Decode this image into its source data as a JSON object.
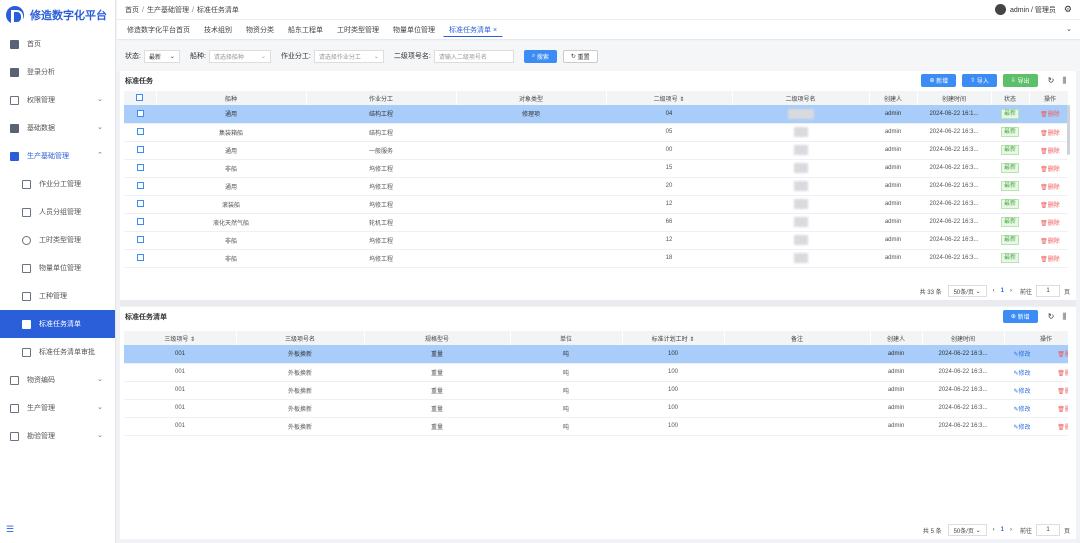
{
  "app": {
    "title": "修造数字化平台"
  },
  "sidebar": {
    "items": [
      {
        "label": "首页",
        "icon": "home-icon"
      },
      {
        "label": "登录分析",
        "icon": "monitor-icon"
      },
      {
        "label": "权限管理",
        "icon": "window-icon",
        "chevron": "chevron-down"
      },
      {
        "label": "基础数据",
        "icon": "database-icon",
        "chevron": "chevron-down"
      },
      {
        "label": "生产基础管理",
        "icon": "folder-icon",
        "chevron": "chevron-up"
      }
    ],
    "subitems": [
      {
        "label": "作业分工管理",
        "icon": "doc-icon"
      },
      {
        "label": "人员分组管理",
        "icon": "people-icon"
      },
      {
        "label": "工时类型管理",
        "icon": "search-icon"
      },
      {
        "label": "物量单位管理",
        "icon": "scale-icon"
      },
      {
        "label": "工种管理",
        "icon": "monitor-icon"
      },
      {
        "label": "标准任务清单",
        "icon": "task-icon",
        "active": true
      },
      {
        "label": "标准任务清单审批",
        "icon": "approve-icon"
      }
    ],
    "bottom_items": [
      {
        "label": "物资编码",
        "icon": "box-icon",
        "chevron": "chevron-down"
      },
      {
        "label": "生产管理",
        "icon": "doc-icon",
        "chevron": "chevron-down"
      },
      {
        "label": "勘验管理",
        "icon": "window-icon",
        "chevron": "chevron-down"
      }
    ],
    "collapse_icon": "indent-icon"
  },
  "breadcrumb": [
    "首页",
    "生产基础管理",
    "标准任务清单"
  ],
  "user": {
    "label": "admin / 管理员"
  },
  "tabs": [
    "修造数字化平台首页",
    "技术组别",
    "物资分类",
    "船东工程单",
    "工时类型管理",
    "物量单位管理",
    "标准任务清单 ×"
  ],
  "filters": {
    "status_label": "状态:",
    "status_value": "最新",
    "ship_label": "船种:",
    "ship_placeholder": "请选择船种",
    "work_label": "作业分工:",
    "work_placeholder": "请选择作业分工",
    "item2_label": "二级项号名:",
    "item2_placeholder": "请输入二级项号名",
    "search_btn": "搜索",
    "reset_btn": "重置"
  },
  "upper": {
    "title": "标准任务",
    "add_btn": "新增",
    "import_btn": "导入",
    "export_btn": "导出",
    "headers": [
      "船种",
      "作业分工",
      "对象类型",
      "二级项号",
      "二级项号名",
      "创建人",
      "创建时间",
      "状态",
      "操作"
    ],
    "rows": [
      [
        "通用",
        "结构工程",
        "修理项",
        "04",
        "admin",
        "2024-06-22 16:1...",
        "最新",
        "删除"
      ],
      [
        "集装箱船",
        "结构工程",
        "",
        "05",
        "admin",
        "2024-06-22 16:3...",
        "最新",
        "删除"
      ],
      [
        "通用",
        "一般服务",
        "",
        "00",
        "admin",
        "2024-06-22 16:3...",
        "最新",
        "删除"
      ],
      [
        "非船",
        "坞修工程",
        "",
        "15",
        "admin",
        "2024-06-22 16:3...",
        "最新",
        "删除"
      ],
      [
        "通用",
        "坞修工程",
        "",
        "20",
        "admin",
        "2024-06-22 16:3...",
        "最新",
        "删除"
      ],
      [
        "滚装船",
        "坞修工程",
        "",
        "12",
        "admin",
        "2024-06-22 16:3...",
        "最新",
        "删除"
      ],
      [
        "液化天然气船",
        "轮机工程",
        "",
        "66",
        "admin",
        "2024-06-22 16:3...",
        "最新",
        "删除"
      ],
      [
        "非船",
        "坞修工程",
        "",
        "12",
        "admin",
        "2024-06-22 16:3...",
        "最新",
        "删除"
      ],
      [
        "非船",
        "坞修工程",
        "",
        "18",
        "admin",
        "2024-06-22 16:3...",
        "最新",
        "删除"
      ]
    ],
    "pager": {
      "total": "共 33 条",
      "size": "50条/页",
      "page": "1",
      "goto": "前往",
      "goto_value": "1",
      "unit": "页"
    }
  },
  "lower": {
    "title": "标准任务清单",
    "add_btn": "新增",
    "headers": [
      "三级项号",
      "三级项号名",
      "规格型号",
      "单位",
      "标准计划工时",
      "备注",
      "创建人",
      "创建时间",
      "操作"
    ],
    "rows": [
      [
        "001",
        "外板换新",
        "重量",
        "吨",
        "100",
        "",
        "admin",
        "2024-06-22 16:3...",
        "修改",
        "删除"
      ],
      [
        "001",
        "外板换新",
        "重量",
        "吨",
        "100",
        "",
        "admin",
        "2024-06-22 16:3...",
        "修改",
        "删除"
      ],
      [
        "001",
        "外板换新",
        "重量",
        "吨",
        "100",
        "",
        "admin",
        "2024-06-22 16:3...",
        "修改",
        "删除"
      ],
      [
        "001",
        "外板换新",
        "重量",
        "吨",
        "100",
        "",
        "admin",
        "2024-06-22 16:3...",
        "修改",
        "删除"
      ],
      [
        "001",
        "外板换新",
        "重量",
        "吨",
        "100",
        "",
        "admin",
        "2024-06-22 16:3...",
        "修改",
        "删除"
      ]
    ],
    "pager": {
      "total": "共 5 条",
      "size": "50条/页",
      "page": "1",
      "goto": "前往",
      "goto_value": "1",
      "unit": "页"
    }
  }
}
